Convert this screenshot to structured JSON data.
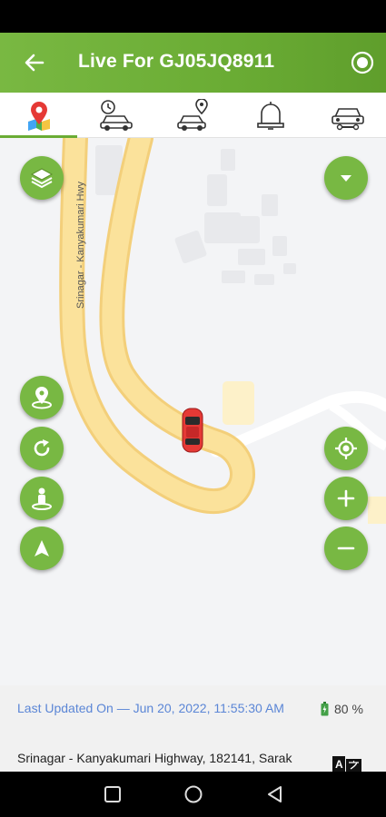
{
  "header": {
    "title": "Live For GJ05JQ8911",
    "back_icon": "arrow-left-icon",
    "record_icon": "record-icon"
  },
  "tabs": [
    {
      "name": "map-pin",
      "icon": "map-pin-icon",
      "active": true
    },
    {
      "name": "history",
      "icon": "car-clock-icon",
      "active": false
    },
    {
      "name": "car-location",
      "icon": "car-pin-icon",
      "active": false
    },
    {
      "name": "alerts",
      "icon": "bell-icon",
      "active": false
    },
    {
      "name": "vehicle-service",
      "icon": "car-wrench-icon",
      "active": false
    }
  ],
  "map": {
    "road_label": "Srinagar - Kanyakumari Hwy",
    "vehicle_icon": "red-car-icon"
  },
  "info": {
    "last_updated": "Last Updated On — Jun 20, 2022, 11:55:30 AM",
    "battery": "80 %",
    "address": "Srinagar - Kanyakumari Highway, 182141, Sarak"
  },
  "colors": {
    "brand": "#6aac34",
    "accent_link": "#5b86d6",
    "road": "#fbe29b",
    "vehicle": "#e53935"
  }
}
